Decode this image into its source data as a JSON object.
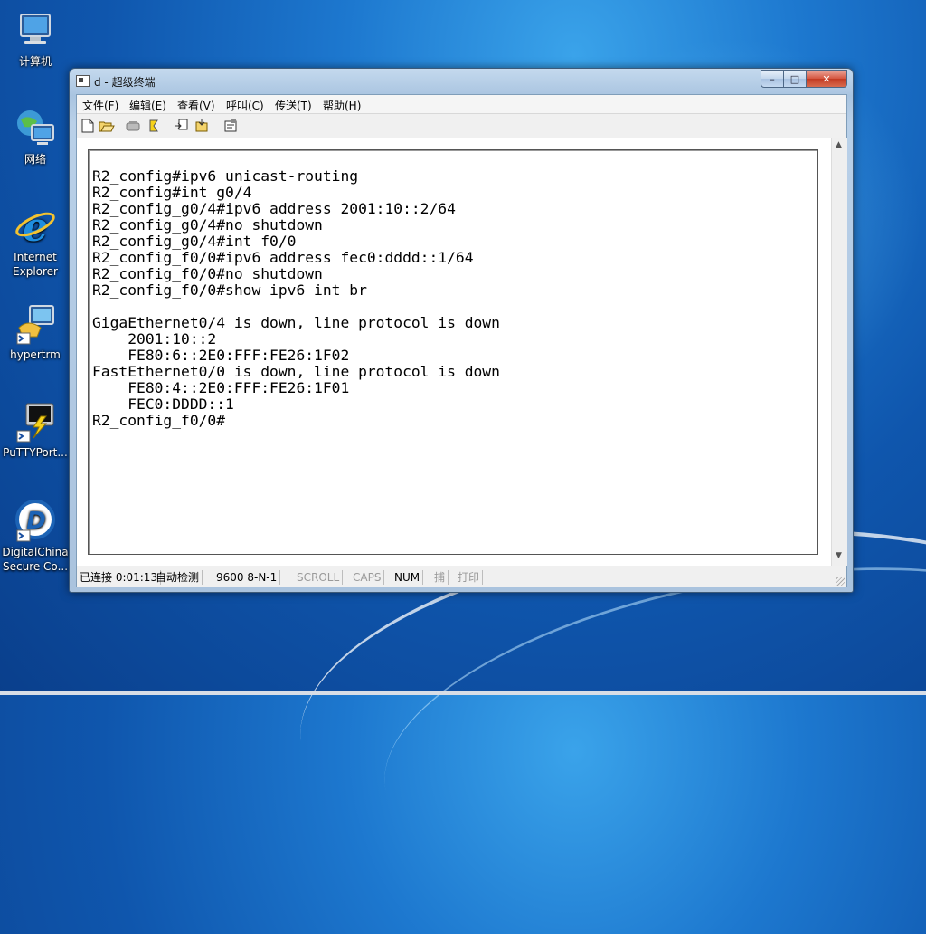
{
  "desktop": {
    "icons": [
      {
        "label": "计算机",
        "icon": "computer-icon"
      },
      {
        "label": "网络",
        "icon": "network-icon"
      },
      {
        "label": "Internet Explorer",
        "icon": "ie-icon"
      },
      {
        "label": "hypertrm",
        "icon": "hyperterminal-icon"
      },
      {
        "label": "PuTTYPort...",
        "icon": "putty-icon"
      },
      {
        "label": "DigitalChina Secure Co...",
        "icon": "digitalchina-icon"
      }
    ]
  },
  "window": {
    "title": "d - 超级终端",
    "controls": {
      "minimize": "–",
      "maximize": "□",
      "close": "✕"
    }
  },
  "menubar": {
    "items": [
      {
        "label": "文件(F)"
      },
      {
        "label": "编辑(E)"
      },
      {
        "label": "查看(V)"
      },
      {
        "label": "呼叫(C)"
      },
      {
        "label": "传送(T)"
      },
      {
        "label": "帮助(H)"
      }
    ]
  },
  "toolbar": {
    "buttons": [
      "new-icon",
      "open-icon",
      "disconnect-icon",
      "dial-icon",
      "send-icon",
      "receive-icon",
      "properties-icon"
    ]
  },
  "terminal": {
    "lines": [
      "R2_config#ipv6 unicast-routing",
      "R2_config#int g0/4",
      "R2_config_g0/4#ipv6 address 2001:10::2/64",
      "R2_config_g0/4#no shutdown",
      "R2_config_g0/4#int f0/0",
      "R2_config_f0/0#ipv6 address fec0:dddd::1/64",
      "R2_config_f0/0#no shutdown",
      "R2_config_f0/0#show ipv6 int br",
      "",
      "GigaEthernet0/4 is down, line protocol is down",
      "    2001:10::2",
      "    FE80:6::2E0:FFF:FE26:1F02",
      "FastEthernet0/0 is down, line protocol is down",
      "    FE80:4::2E0:FFF:FE26:1F01",
      "    FEC0:DDDD::1",
      "R2_config_f0/0#"
    ]
  },
  "statusbar": {
    "connected": "已连接 0:01:13",
    "detect": "自动检测",
    "port": "9600 8-N-1",
    "scroll": "SCROLL",
    "caps": "CAPS",
    "num": "NUM",
    "capture": "捕",
    "print": "打印"
  }
}
